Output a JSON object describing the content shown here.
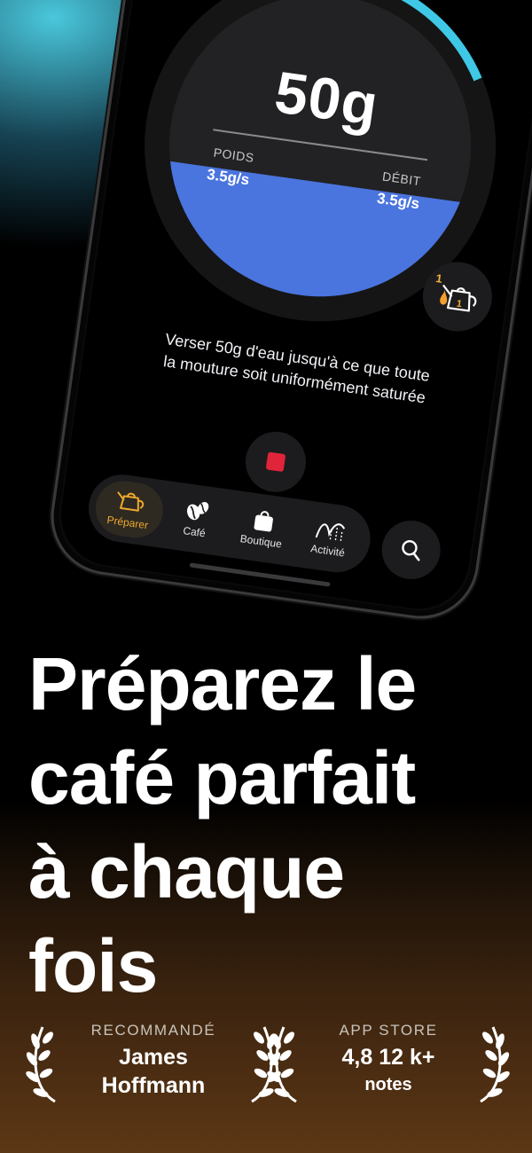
{
  "dial": {
    "weight": "50g",
    "weight_label": "POIDS",
    "weight_rate": "3.5g/s",
    "flow_label": "DÉBIT",
    "flow_rate": "3.5g/s",
    "fill_fraction": 0.38
  },
  "kettle": {
    "step": "1",
    "step_inner": "1"
  },
  "instruction": {
    "line1": "Verser 50g d'eau jusqu'à ce que toute",
    "line2": "la mouture soit uniformément saturée"
  },
  "tabs": [
    {
      "label": "Préparer",
      "icon": "kettle-icon",
      "active": true
    },
    {
      "label": "Café",
      "icon": "coffee-bean-icon",
      "active": false
    },
    {
      "label": "Boutique",
      "icon": "shopping-bag-icon",
      "active": false
    },
    {
      "label": "Activité",
      "icon": "activity-chart-icon",
      "active": false
    }
  ],
  "search": {
    "icon": "search-icon"
  },
  "headline": {
    "line1": "Préparez le",
    "line2": "café parfait",
    "line3": "à chaque",
    "line4": "fois"
  },
  "badges": {
    "recommended": {
      "caption": "RECOMMANDÉ",
      "line1": "James",
      "line2": "Hoffmann"
    },
    "appstore": {
      "caption": "APP STORE",
      "rating": "4,8 12 k+",
      "sub": "notes"
    }
  },
  "colors": {
    "accent_orange": "#f0a92d",
    "dial_blue": "#4a74de",
    "stop_red": "#e0243a",
    "ring_cyan": "#3fc7e6"
  }
}
